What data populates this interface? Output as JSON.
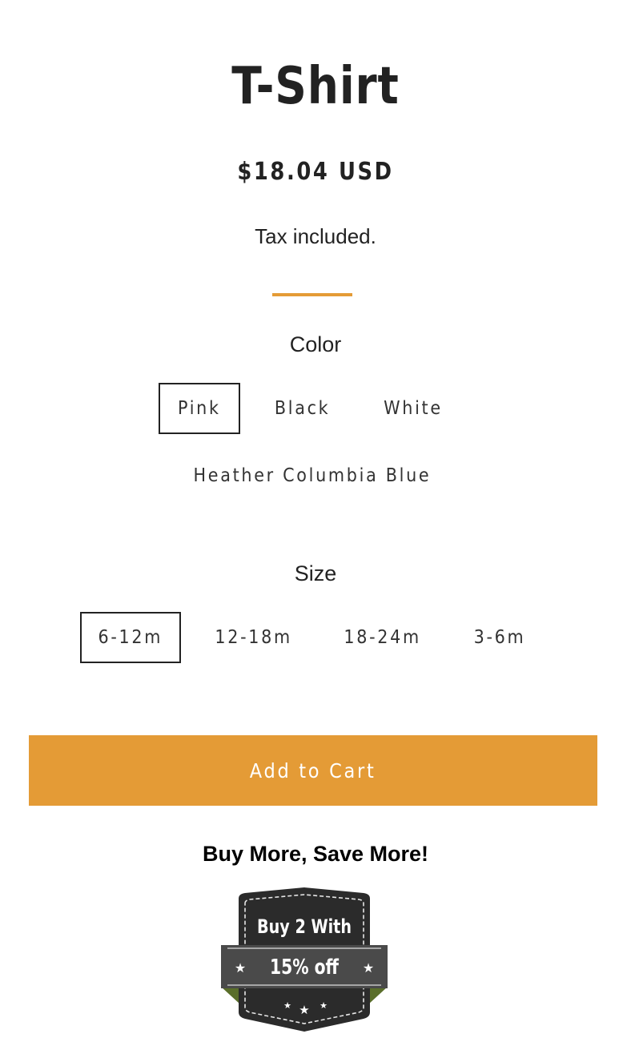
{
  "product": {
    "title": "T-Shirt",
    "price": "$18.04 USD",
    "tax_note": "Tax included."
  },
  "colors": {
    "accent": "#e49b36",
    "text": "#222222",
    "badge_dark": "#2b2b2b",
    "badge_ribbon": "#4a4a4a",
    "badge_tab": "#5a6e2a"
  },
  "color_option": {
    "label": "Color",
    "selected": "Pink",
    "values": [
      "Pink",
      "Black",
      "White",
      "Heather Columbia Blue"
    ]
  },
  "size_option": {
    "label": "Size",
    "selected": "6-12m",
    "values": [
      "6-12m",
      "12-18m",
      "18-24m",
      "3-6m"
    ]
  },
  "cart": {
    "add_label": "Add to Cart"
  },
  "promo": {
    "heading": "Buy More, Save More!",
    "badge_line1": "Buy 2 With",
    "badge_line2": "15% off"
  }
}
